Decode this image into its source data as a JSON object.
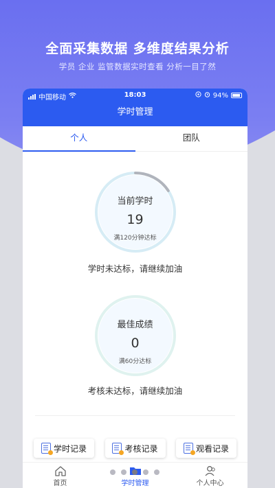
{
  "promo": {
    "title": "全面采集数据 多维度结果分析",
    "subtitle": "学员 企业 监管数据实时查看 分析一目了然"
  },
  "status_bar": {
    "carrier": "中国移动",
    "time": "18:03",
    "battery": "94%"
  },
  "nav": {
    "title": "学时管理"
  },
  "tabs": [
    {
      "label": "个人",
      "active": true
    },
    {
      "label": "团队",
      "active": false
    }
  ],
  "current_hours": {
    "label": "当前学时",
    "value": "19",
    "note": "满120分钟达标",
    "progress": 0.158,
    "status": "学时未达标，请继续加油"
  },
  "best_score": {
    "label": "最佳成绩",
    "value": "0",
    "note": "满60分达标",
    "progress": 0,
    "status": "考核未达标，请继续加油"
  },
  "actions": [
    {
      "label": "学时记录",
      "icon": "study-record-icon"
    },
    {
      "label": "考核记录",
      "icon": "exam-record-icon"
    },
    {
      "label": "观看记录",
      "icon": "watch-record-icon"
    }
  ],
  "bottom_nav": [
    {
      "label": "首页",
      "icon": "home-icon",
      "active": false
    },
    {
      "label": "学时管理",
      "icon": "folder-icon",
      "active": true
    },
    {
      "label": "个人中心",
      "icon": "user-center-icon",
      "active": false
    }
  ],
  "colors": {
    "primary": "#2c5bf0",
    "background_top": "#6a6ff0",
    "ring_track": "#d6ecf5",
    "ring_progress": "#b0b4bc"
  }
}
